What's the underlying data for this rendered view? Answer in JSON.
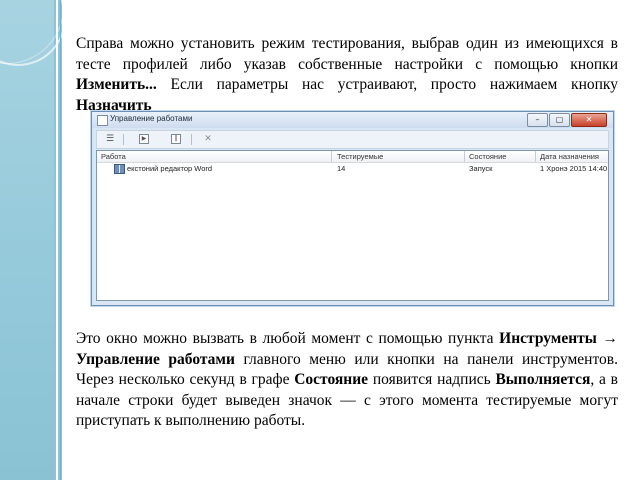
{
  "paragraph1": {
    "before": "Справа можно установить режим тестирования, выбрав один из имеющихся в тесте профилей либо указав собственные настройки с помощью кнопки ",
    "b1": "Изменить...",
    "middle": " Если параметры нас устраивают, просто нажимаем кнопку ",
    "b2": "Назначить"
  },
  "window": {
    "title": "Управление работами",
    "controls": [
      "–",
      "▢",
      "✕"
    ],
    "toolbar_icons": [
      "list-icon",
      "play-icon",
      "pause-icon",
      "delete-icon"
    ],
    "columns": [
      "Работа",
      "Тестируемые",
      "Состояние",
      "Дата назначения"
    ],
    "rows": [
      {
        "work": "екстоний редактор Word",
        "testees": "14",
        "status": "Запуск",
        "date": "1 Хронэ 2015 14:40"
      }
    ]
  },
  "paragraph2": {
    "t1": "Это окно можно вызвать в любой момент с помощью пункта ",
    "b1": "Инструменты → Управление работами",
    "t2": " главного меню или кнопки на панели инструментов. Через несколько секунд в графе ",
    "b2": "Состояние",
    "t3": " появится надпись ",
    "b3": "Выполняется",
    "t4": ", а в начале строки будет выведен значок — с этого момента тестируемые могут приступать к выполнению работы."
  }
}
